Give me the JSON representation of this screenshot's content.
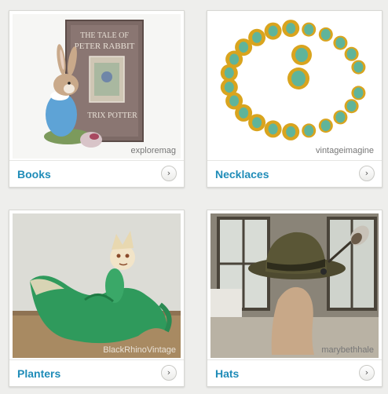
{
  "cards": [
    {
      "label": "Books",
      "credit": "exploremag",
      "arrow": "›",
      "image": "peter-rabbit-book-and-figurine"
    },
    {
      "label": "Necklaces",
      "credit": "vintageimagine",
      "arrow": "›",
      "image": "gold-green-necklace-and-earrings"
    },
    {
      "label": "Planters",
      "credit": "BlackRhinoVintage",
      "arrow": "›",
      "image": "green-elf-shoe-planter"
    },
    {
      "label": "Hats",
      "credit": "marybethhale",
      "arrow": "›",
      "image": "green-fedora-with-feather"
    }
  ],
  "book_cover": {
    "line1": "THE TALE OF",
    "line2": "PETER RABBIT",
    "line3": "TRIX POTTER"
  },
  "colors": {
    "link": "#1f8cb8",
    "background": "#eeeeec"
  }
}
